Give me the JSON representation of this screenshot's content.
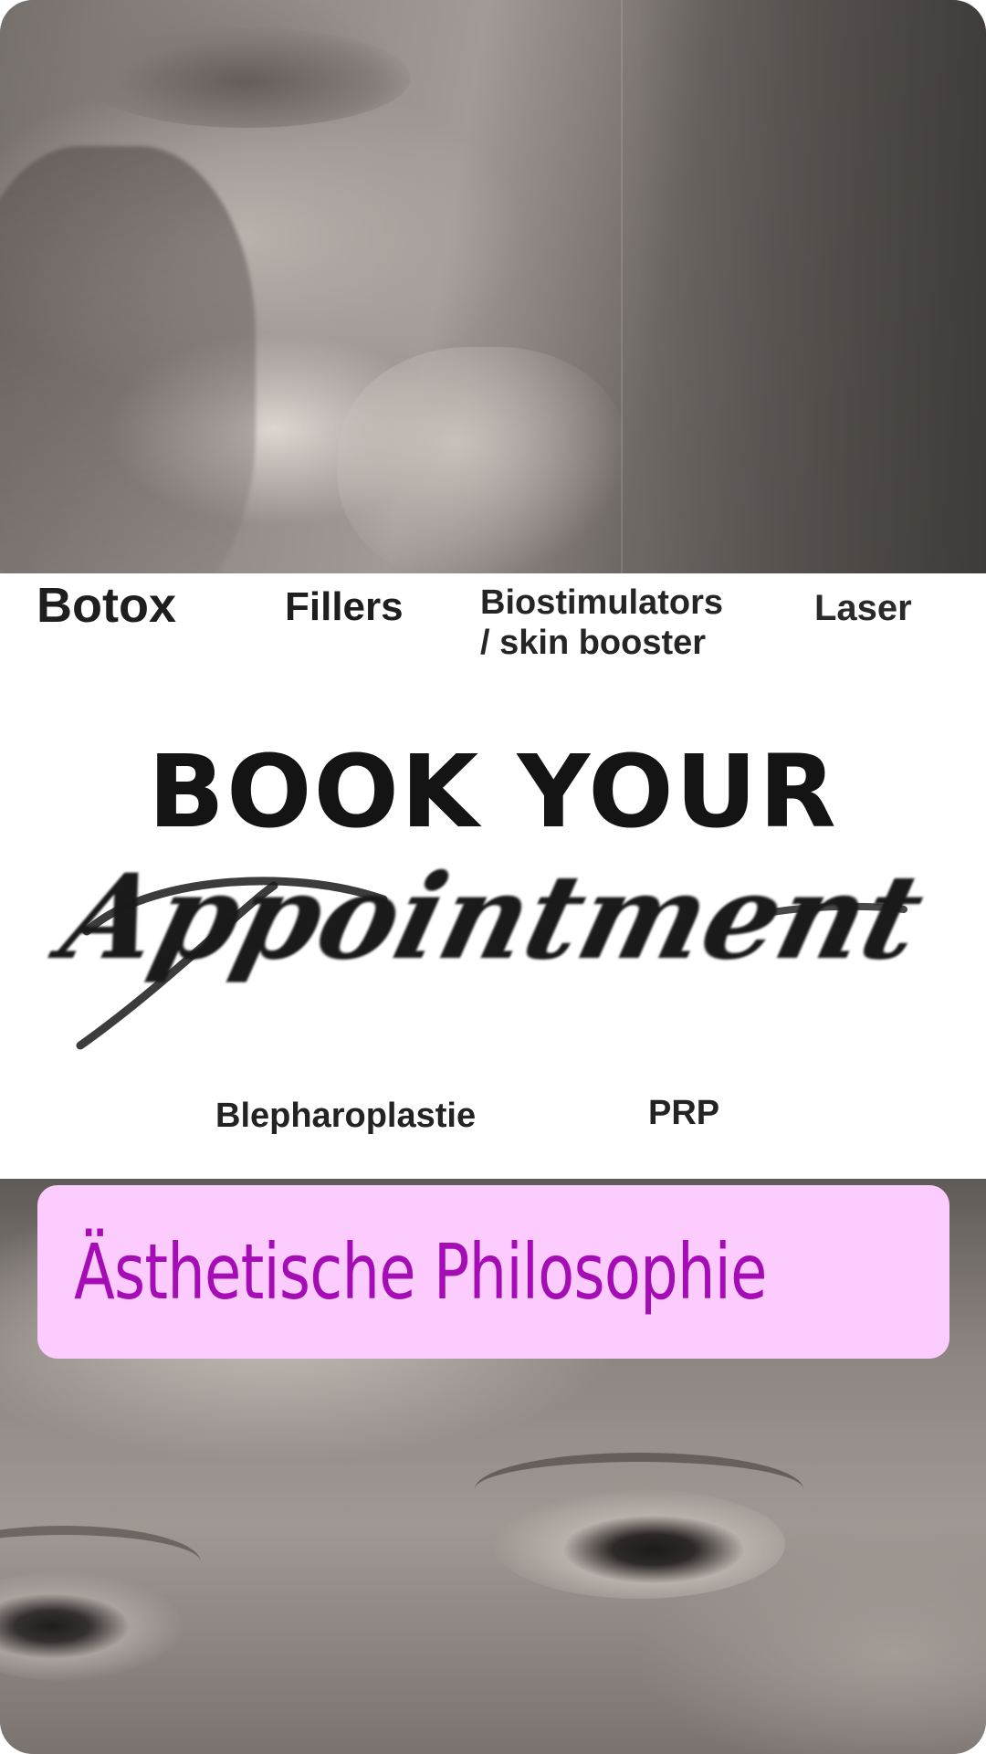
{
  "services_top": {
    "botox": "Botox",
    "fillers": "Fillers",
    "biostimulators_line1": "Biostimulators",
    "biostimulators_line2": "/ skin booster",
    "laser": "Laser"
  },
  "headline": "BOOK YOUR",
  "script_word": "Appointment",
  "services_bottom": {
    "blepharoplastie": "Blepharoplastie",
    "prp": "PRP"
  },
  "sticker": {
    "text": "Ästhetische Philosophie",
    "background_color": "#fbccfd",
    "text_color": "#a60cb6"
  }
}
